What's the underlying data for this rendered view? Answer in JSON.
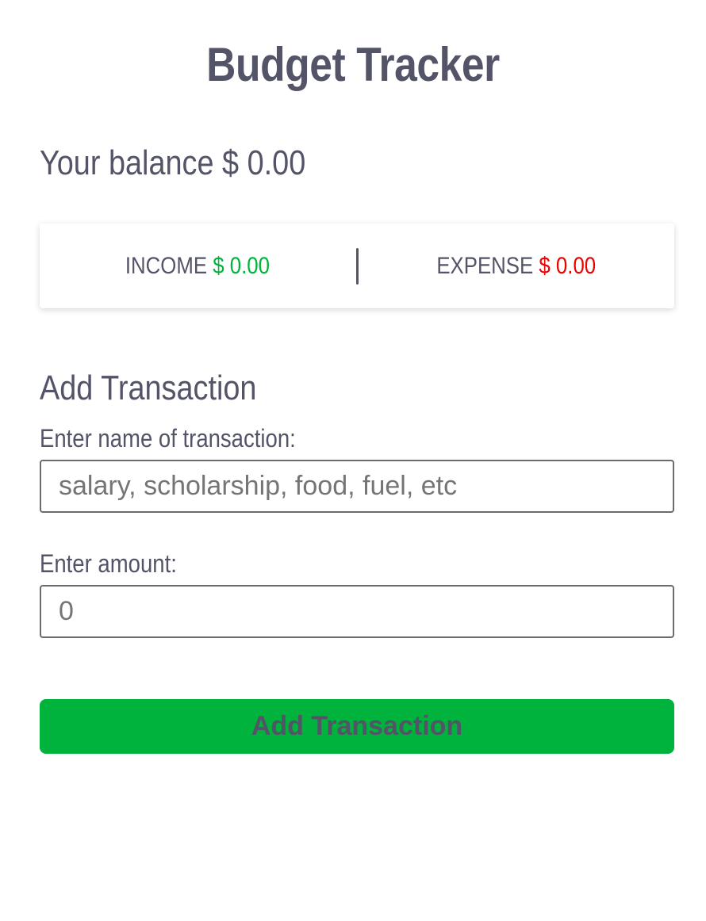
{
  "header": {
    "title": "Budget Tracker"
  },
  "balance": {
    "label": "Your balance",
    "value": "$ 0.00"
  },
  "summary": {
    "income_label": "INCOME",
    "income_value": "$ 0.00",
    "expense_label": "EXPENSE",
    "expense_value": "$ 0.00"
  },
  "form": {
    "title": "Add Transaction",
    "name_label": "Enter name of transaction:",
    "name_placeholder": "salary, scholarship, food, fuel, etc",
    "name_value": "",
    "amount_label": "Enter amount:",
    "amount_placeholder": "0",
    "amount_value": "",
    "submit_label": "Add Transaction"
  },
  "colors": {
    "text": "#535468",
    "income": "#00b33c",
    "expense": "#ee0000",
    "button": "#00b33c"
  }
}
